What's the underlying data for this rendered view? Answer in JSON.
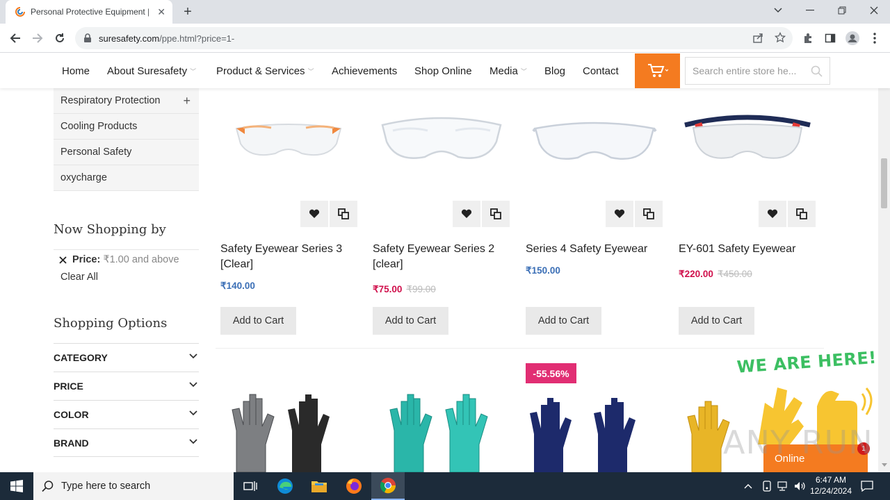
{
  "browser": {
    "tab_title": "Personal Protective Equipment |",
    "url_domain": "suresafety.com",
    "url_path": "/ppe.html?price=1-"
  },
  "nav": {
    "items": [
      {
        "label": "Home"
      },
      {
        "label": "About Suresafety"
      },
      {
        "label": "Product & Services"
      },
      {
        "label": "Achievements"
      },
      {
        "label": "Shop Online"
      },
      {
        "label": "Media"
      },
      {
        "label": "Blog"
      },
      {
        "label": "Contact"
      }
    ],
    "search_placeholder": "Search entire store he..."
  },
  "sidebar": {
    "categories": [
      "Respiratory Protection",
      "Cooling Products",
      "Personal Safety",
      "oxycharge"
    ],
    "now_shopping_title": "Now Shopping by",
    "filter_label": "Price:",
    "filter_value": "₹1.00 and above",
    "clear_all": "Clear All",
    "shopping_options_title": "Shopping Options",
    "options": [
      "CATEGORY",
      "PRICE",
      "COLOR",
      "BRAND"
    ]
  },
  "products": [
    {
      "name": "Safety Eyewear Series 3 [Clear]",
      "price": "₹140.00",
      "old_price": ""
    },
    {
      "name": "Safety Eyewear Series 2 [clear]",
      "price": "₹75.00",
      "old_price": "₹99.00"
    },
    {
      "name": "Series 4 Safety Eyewear",
      "price": "₹150.00",
      "old_price": ""
    },
    {
      "name": "EY-601 Safety Eyewear",
      "price": "₹220.00",
      "old_price": "₹450.00"
    }
  ],
  "add_to_cart_label": "Add to Cart",
  "discount_badge": "-55.56%",
  "chat_widget": {
    "banner": "WE ARE HERE!",
    "status": "Online",
    "badge_count": "1"
  },
  "watermark": "ANY RUN",
  "taskbar": {
    "search_placeholder": "Type here to search",
    "time": "6:47 AM",
    "date": "12/24/2024"
  },
  "colors": {
    "accent_orange": "#f47b20",
    "price_blue": "#3b6fb6",
    "price_red": "#d0104c",
    "discount_pink": "#e12e73"
  }
}
